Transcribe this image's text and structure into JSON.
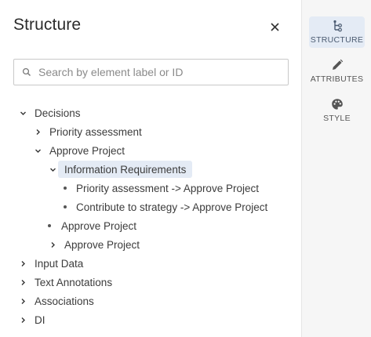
{
  "panel": {
    "title": "Structure",
    "close_icon": "close-icon"
  },
  "search": {
    "placeholder": "Search by element label or ID",
    "value": ""
  },
  "tree": {
    "decisions": "Decisions",
    "priority_assessment": "Priority assessment",
    "approve_project": "Approve Project",
    "information_requirements": "Information Requirements",
    "req_1": "Priority assessment -> Approve Project",
    "req_2": "Contribute to strategy -> Approve Project",
    "approve_project_2": "Approve Project",
    "approve_project_3": "Approve Project",
    "input_data": "Input Data",
    "text_annotations": "Text Annotations",
    "associations": "Associations",
    "di": "DI"
  },
  "rail": {
    "structure": "STRUCTURE",
    "attributes": "ATTRIBUTES",
    "style": "STYLE"
  },
  "colors": {
    "selected_bg": "#e4ebf5",
    "rail_bg": "#f6f6f6",
    "text": "#3c3c3c"
  }
}
